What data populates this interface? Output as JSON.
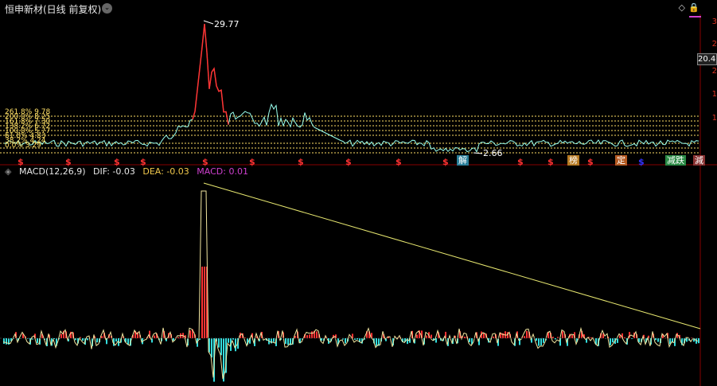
{
  "header": {
    "title": "恒申新材(日线 前复权)",
    "dropdown": "⌄",
    "corner_icons": [
      "◇",
      "🔒"
    ]
  },
  "price_panel": {
    "high_label": "29.77",
    "low_label": "2.66",
    "right_price": "20.4",
    "right_axis_digits": [
      "3",
      "2",
      "2",
      "1",
      "1"
    ],
    "fib_labels": [
      "261.8% 9.78",
      "200.0% 8.25",
      "161.8% 7.30",
      "138.2% 6.72",
      "100.0% 5.77",
      "61.8% 4.83",
      "38.2% 4.24",
      "0.0% 3.29"
    ],
    "markers_s": [
      "$",
      "$",
      "$",
      "$",
      "$",
      "$",
      "$",
      "$",
      "$",
      "$",
      "$",
      "$",
      "$",
      "$"
    ],
    "badges": [
      {
        "text": "解",
        "bg": "#39b"
      },
      {
        "text": "榜",
        "bg": "#c82"
      },
      {
        "text": "定",
        "bg": "#c62"
      },
      {
        "text": "减跌",
        "bg": "#2a4"
      },
      {
        "text": "減",
        "bg": "#a44"
      }
    ]
  },
  "macd_panel": {
    "name": "MACD(12,26,9)",
    "dif_label": "DIF: -0.03",
    "dea_label": "DEA: -0.03",
    "macd_label": "MACD: 0.01",
    "dif_color": "#e8e8e8",
    "dea_color": "#f2c94c",
    "macd_color": "#d040d0"
  },
  "colors": {
    "up": "#ff3333",
    "down": "#33dddd",
    "ma": "#f5f580",
    "fib": "#ffe066"
  }
}
